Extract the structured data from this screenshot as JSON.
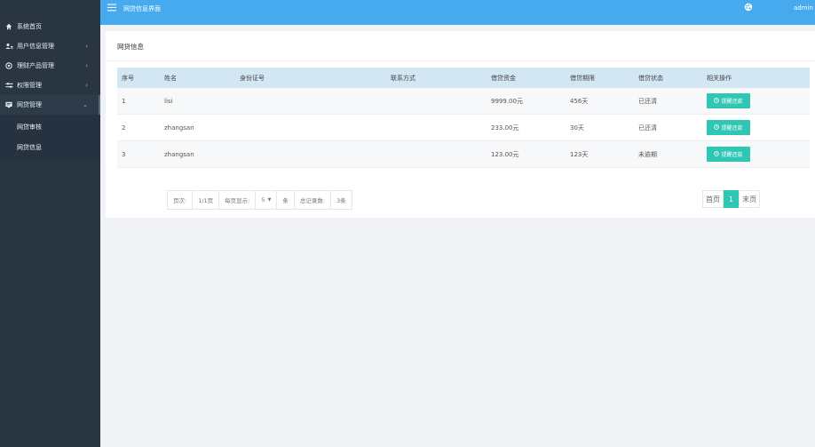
{
  "sidebar": {
    "items": [
      {
        "label": "系统首页",
        "icon": "home-icon"
      },
      {
        "label": "用户信息管理",
        "icon": "users-icon",
        "arrow": "›"
      },
      {
        "label": "理财产品管理",
        "icon": "finance-icon",
        "arrow": "›"
      },
      {
        "label": "权限管理",
        "icon": "permission-icon",
        "arrow": "›"
      },
      {
        "label": "网贷管理",
        "icon": "loan-icon",
        "arrow": "⌄"
      }
    ],
    "sub_items": [
      {
        "label": "网贷审核"
      },
      {
        "label": "网贷信息"
      }
    ]
  },
  "header": {
    "title": "网贷信息界面",
    "user": "admin"
  },
  "panel": {
    "title": "网贷信息"
  },
  "table": {
    "columns": [
      "序号",
      "姓名",
      "身份证号",
      "联系方式",
      "借贷资金",
      "借贷期限",
      "借贷状态",
      "相关操作"
    ],
    "rows": [
      {
        "id": "1",
        "name": "lisi",
        "id_card": "",
        "contact": "",
        "amount": "9999.00元",
        "term": "456天",
        "status": "已还清",
        "action": "提醒还款"
      },
      {
        "id": "2",
        "name": "zhangsan",
        "id_card": "",
        "contact": "",
        "amount": "233.00元",
        "term": "30天",
        "status": "已还清",
        "action": "提醒还款"
      },
      {
        "id": "3",
        "name": "zhangsan",
        "id_card": "",
        "contact": "",
        "amount": "123.00元",
        "term": "123天",
        "status": "未逾期",
        "action": "提醒还款"
      }
    ]
  },
  "pagination": {
    "page_label": "页次:",
    "page_value": "1/1页",
    "per_page_label": "每页显示:",
    "per_page_value": "5",
    "per_page_unit": "条",
    "total_label": "总记录数:",
    "total_value": "3条",
    "first": "首页",
    "current": "1",
    "last": "末页"
  },
  "colors": {
    "topbar": "#48aaee",
    "sidebar": "#2a3542",
    "accent": "#2fc6b4",
    "table_header": "#d3e6f4"
  }
}
